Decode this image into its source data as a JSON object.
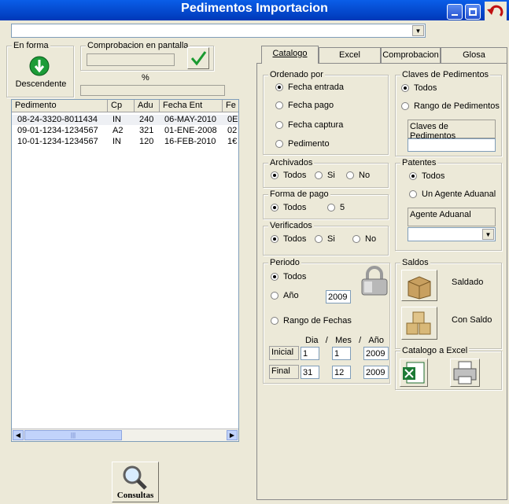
{
  "window": {
    "title": "Pedimentos Importacion"
  },
  "top_combo": {
    "value": ""
  },
  "left": {
    "en_forma_label": "En forma",
    "order_button_label": "Descendente",
    "comprobacion_label": "Comprobacion en pantalla",
    "percent_label": "%",
    "list": {
      "columns": [
        "Pedimento",
        "Cp",
        "Adu",
        "Fecha Ent",
        "Fe"
      ],
      "rows": [
        {
          "pedimento": "08-24-3320-8011434",
          "cp": "IN",
          "adu": "240",
          "fecha": "06-MAY-2010",
          "fe": "0E"
        },
        {
          "pedimento": "09-01-1234-1234567",
          "cp": "A2",
          "adu": "321",
          "fecha": "01-ENE-2008",
          "fe": "02"
        },
        {
          "pedimento": "10-01-1234-1234567",
          "cp": "IN",
          "adu": "120",
          "fecha": "16-FEB-2010",
          "fe": "1€"
        }
      ]
    },
    "consultas_label": "Consultas"
  },
  "tabs": [
    "Catalogo",
    "Excel",
    "Comprobacion",
    "Glosa"
  ],
  "catalogo": {
    "ordenado_por": {
      "label": "Ordenado por",
      "options": [
        "Fecha entrada",
        "Fecha pago",
        "Fecha captura",
        "Pedimento"
      ],
      "selected": 0
    },
    "claves": {
      "label": "Claves de Pedimentos",
      "options": [
        "Todos",
        "Rango de Pedimentos"
      ],
      "selected": 0,
      "field_label": "Claves de Pedimentos",
      "field_value": ""
    },
    "archivados": {
      "label": "Archivados",
      "options": [
        "Todos",
        "Si",
        "No"
      ],
      "selected": 0
    },
    "forma_pago": {
      "label": "Forma de pago",
      "options": [
        "Todos",
        "5"
      ],
      "selected": 0
    },
    "verificados": {
      "label": "Verificados",
      "options": [
        "Todos",
        "Si",
        "No"
      ],
      "selected": 0
    },
    "patentes": {
      "label": "Patentes",
      "options": [
        "Todos",
        "Un Agente Aduanal"
      ],
      "selected": 0,
      "field_label": "Agente Aduanal",
      "combo_value": ""
    },
    "periodo": {
      "label": "Periodo",
      "options": [
        "Todos",
        "Año",
        "Rango de Fechas"
      ],
      "selected": 0,
      "anio_value": "2009",
      "headers": [
        "Dia",
        "/",
        "Mes",
        "/",
        "Año"
      ],
      "inicial_label": "Inicial",
      "final_label": "Final",
      "inicial": {
        "dia": "1",
        "mes": "1",
        "anio": "2009"
      },
      "final": {
        "dia": "31",
        "mes": "12",
        "anio": "2009"
      }
    },
    "saldos": {
      "label": "Saldos",
      "saldado_label": "Saldado",
      "con_saldo_label": "Con Saldo"
    },
    "catalogo_excel": {
      "label": "Catalogo a Excel"
    }
  },
  "colors": {
    "title_bar": "#0a5ee8",
    "window_bg": "#ece9d8"
  }
}
